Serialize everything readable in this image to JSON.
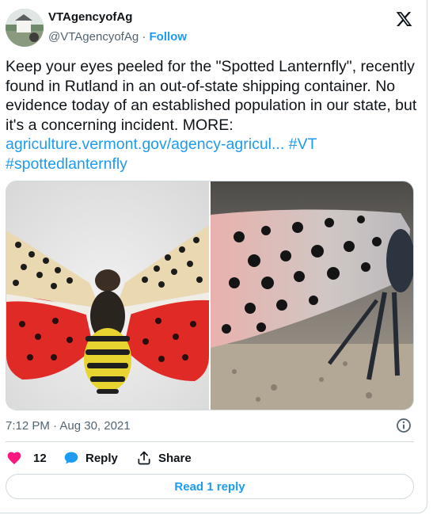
{
  "author": {
    "display_name": "VTAgencyofAg",
    "handle": "@VTAgencyofAg",
    "separator": "·",
    "follow_label": "Follow"
  },
  "tweet": {
    "text": "Keep your eyes peeled for the \"Spotted Lanternfly\", recently found in Rutland in an out-of-state shipping container.  No evidence today of an established population in our state, but it's a concerning incident. MORE: ",
    "link_text": "agriculture.vermont.gov/agency-agricul...",
    "hashtag_1": "#VT",
    "hashtag_2": "#spottedlanternfly"
  },
  "timestamp": "7:12 PM · Aug 30, 2021",
  "actions": {
    "like_count": "12",
    "reply_label": "Reply",
    "share_label": "Share"
  },
  "read_reply_label": "Read 1 reply",
  "icons": {
    "platform": "x-logo-icon",
    "info": "info-icon",
    "like": "heart-icon",
    "reply": "speech-bubble-icon",
    "share": "share-upload-icon"
  },
  "colors": {
    "link": "#1d9bf0",
    "like": "#f91880",
    "text": "#0f1419",
    "secondary": "#536471"
  }
}
